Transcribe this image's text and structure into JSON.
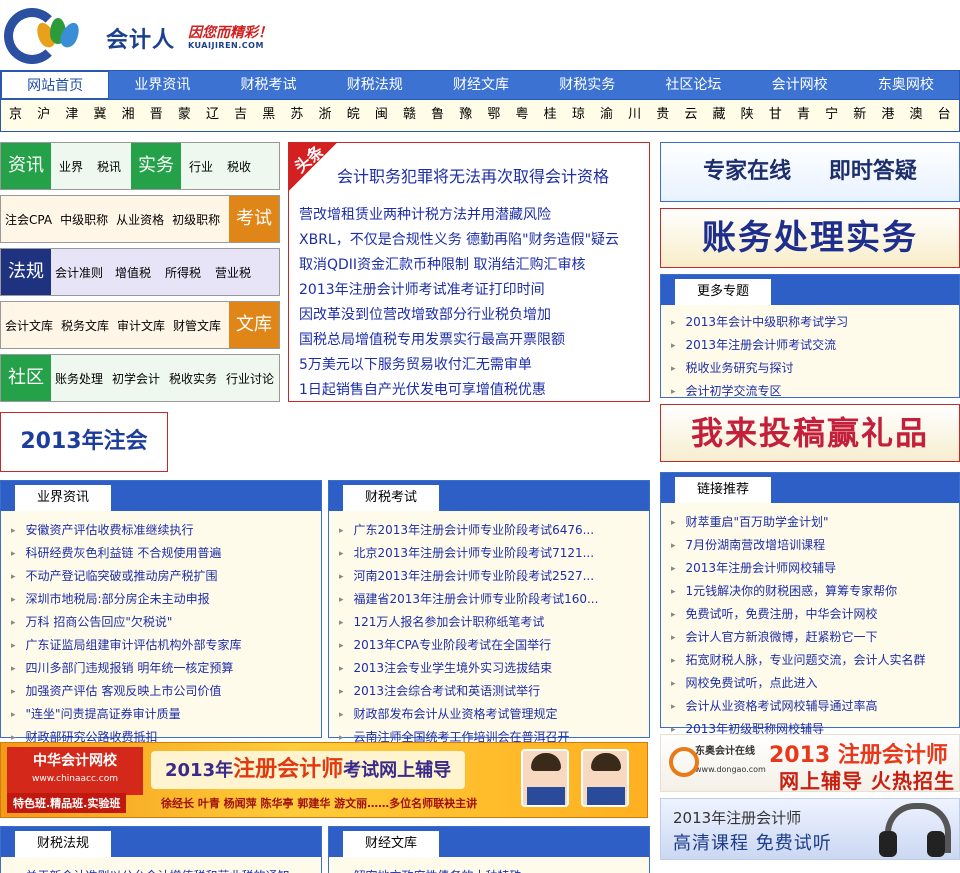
{
  "logo": {
    "name": "会计人",
    "slogan": "因您而精彩！",
    "domain": "KUAIJIREN.COM"
  },
  "nav": [
    "网站首页",
    "业界资讯",
    "财税考试",
    "财税法规",
    "财经文库",
    "财税实务",
    "社区论坛",
    "会计网校",
    "东奥网校"
  ],
  "regions": [
    "京",
    "沪",
    "津",
    "冀",
    "湘",
    "晋",
    "蒙",
    "辽",
    "吉",
    "黑",
    "苏",
    "浙",
    "皖",
    "闽",
    "赣",
    "鲁",
    "豫",
    "鄂",
    "粤",
    "桂",
    "琼",
    "渝",
    "川",
    "贵",
    "云",
    "藏",
    "陕",
    "甘",
    "青",
    "宁",
    "新",
    "港",
    "澳",
    "台"
  ],
  "categories": {
    "row1": {
      "head": "资讯",
      "links": [
        "业界",
        "税讯"
      ],
      "head2": "实务",
      "links2": [
        "行业",
        "税收"
      ]
    },
    "row2": {
      "links": [
        "注会CPA",
        "中级职称",
        "从业资格",
        "初级职称"
      ],
      "tail": "考试"
    },
    "row3": {
      "head": "法规",
      "links": [
        "会计准则",
        "增值税",
        "所得税",
        "营业税"
      ]
    },
    "row4": {
      "links": [
        "会计文库",
        "税务文库",
        "审计文库",
        "财管文库"
      ],
      "tail": "文库"
    },
    "row5": {
      "head": "社区",
      "links": [
        "账务处理",
        "初学会计",
        "税收实务",
        "行业讨论"
      ]
    }
  },
  "headline": {
    "tag": "头条",
    "title": "会计职务犯罪将无法再次取得会计资格",
    "items": [
      "营改增租赁业两种计税方法并用潜藏风险",
      "XBRL，不仅是合规性义务  德勤再陷\"财务造假\"疑云",
      "取消QDII资金汇款币种限制  取消结汇购汇审核",
      "2013年注册会计师考试准考证打印时间",
      "因改革没到位营改增致部分行业税负增加",
      "国税总局增值税专用发票实行最高开票限额",
      "5万美元以下服务贸易收付汇无需审单",
      "1日起销售自产光伏发电可享增值税优惠"
    ]
  },
  "right_banners": {
    "expert": "专家在线  即时答疑",
    "accounting": "账务处理实务",
    "contribute": "我来投稿赢礼品"
  },
  "topics": {
    "title": "更多专题",
    "items": [
      "2013年会计中级职称考试学习",
      "2013年注册会计师考试交流",
      "税收业务研究与探讨",
      "会计初学交流专区"
    ]
  },
  "reg2013": "2013年注会",
  "industry_news": {
    "title": "业界资讯",
    "items": [
      "安徽资产评估收费标准继续执行",
      "科研经费灰色利益链 不合规使用普遍",
      "不动产登记临突破或推动房产税扩围",
      "深圳市地税局:部分房企未主动申报",
      "万科 招商公告回应\"欠税说\"",
      "广东证监局组建审计评估机构外部专家库",
      "四川多部门违规报销 明年统一核定预算",
      "加强资产评估 客观反映上市公司价值",
      "\"连坐\"问责提高证券审计质量",
      "财政部研究公路收费抵扣"
    ]
  },
  "tax_exam": {
    "title": "财税考试",
    "items": [
      "广东2013年注册会计师专业阶段考试6476...",
      "北京2013年注册会计师专业阶段考试7121...",
      "河南2013年注册会计师专业阶段考试2527...",
      "福建省2013年注册会计师专业阶段考试160...",
      "121万人报名参加会计职称纸笔考试",
      "2013年CPA专业阶段考试在全国举行",
      "2013注会专业学生境外实习选拔结束",
      "2013注会综合考试和英语测试举行",
      "财政部发布会计从业资格考试管理规定",
      "云南注师全国统考工作培训会在普洱召开"
    ]
  },
  "links": {
    "title": "链接推荐",
    "items": [
      "财萃重启\"百万助学金计划\"",
      "7月份湖南营改增培训课程",
      "2013年注册会计师网校辅导",
      "1元钱解决你的财税困惑，算筹专家帮你",
      "免费试听，免费注册，中华会计网校",
      "会计人官方新浪微博，赶紧粉它一下",
      "拓宽财税人脉，专业问题交流，会计人实名群",
      "网校免费试听，点此进入",
      "会计从业资格考试网校辅导通过率高",
      "2013年初级职称网校辅导"
    ]
  },
  "ad_chinaacc": {
    "org": "中华会计网校",
    "url": "www.chinaacc.com",
    "headline_pre": "2013年",
    "headline_em": "注册会计师",
    "headline_post": "考试网上辅导",
    "classes": "特色班.精品班.实验班",
    "teachers": "徐经长 叶青 杨闻萍 陈华亭 郭建华 游文丽……多位名师联袂主讲"
  },
  "ad_dongao": {
    "org": "东奥会计在线",
    "url": "www.dongao.com",
    "line1": "2013 注册会计师",
    "line2": "网上辅导 火热招生"
  },
  "ad_hd": {
    "line1": "2013年注册会计师",
    "line2": "高清课程 免费试听"
  },
  "bottom": {
    "law": "财税法规",
    "library": "财经文库",
    "law_first": "关于新会计准则以公允会计增值税和营业税的通知",
    "library_first": "解密地方政府性债务的十种特殊"
  },
  "colors": {
    "nav": "#3c73d2",
    "link": "#1d2ea8",
    "red": "#c42a2a",
    "green": "#25a249",
    "orange": "#e08518",
    "navy": "#1f3280"
  }
}
